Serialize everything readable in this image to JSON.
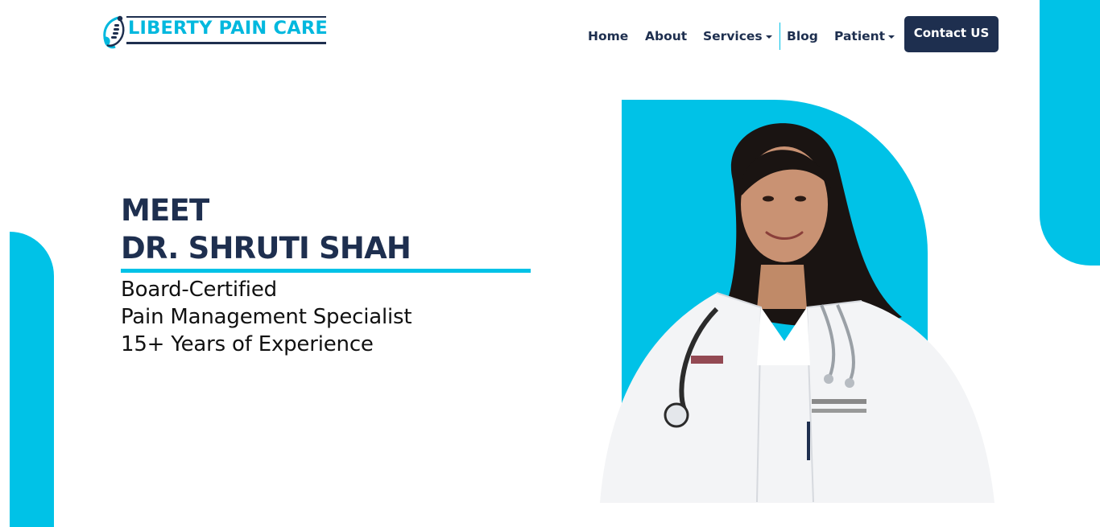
{
  "brand": {
    "name": "LIBERTY PAIN CARE",
    "accent_color": "#00c2e7",
    "navy_color": "#1e2f4f"
  },
  "nav": {
    "items": [
      {
        "label": "Home"
      },
      {
        "label": "About"
      },
      {
        "label": "Services"
      },
      {
        "label": "Blog"
      },
      {
        "label": "Patient"
      }
    ],
    "contact_label": "Contact US"
  },
  "hero": {
    "heading_line1": "MEET",
    "heading_line2": "DR. SHRUTI SHAH",
    "lines": [
      "Board-Certified",
      "Pain Management Specialist",
      "15+ Years of Experience"
    ]
  },
  "icons": [
    "spine-logo-icon",
    "chevron-down-icon"
  ]
}
